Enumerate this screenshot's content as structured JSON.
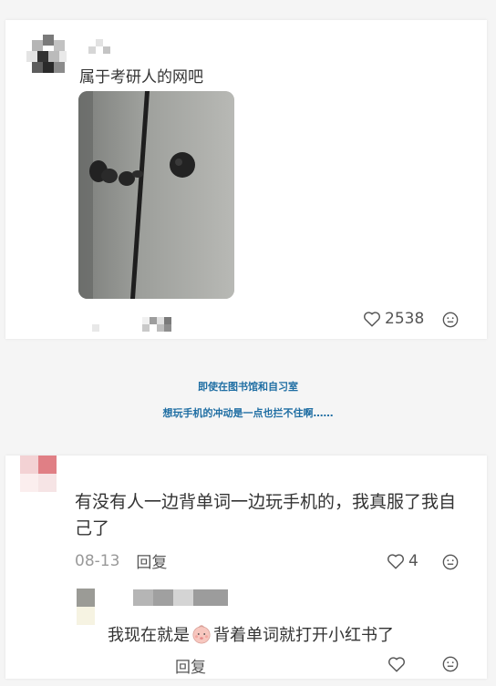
{
  "post": {
    "text": "属于考研人的网吧",
    "likes": "2538",
    "image_icon": "photo-of-white-cabinet-with-black-earbuds"
  },
  "caption": {
    "line1": "即使在图书馆和自习室",
    "line2": "想玩手机的冲动是一点也拦不住啊……"
  },
  "comment": {
    "text": "有没有人一边背单词一边玩手机的，我真服了我自己了",
    "date": "08-13",
    "reply_label": "回复",
    "likes": "4"
  },
  "sub_reply": {
    "text_before": "我现在就是",
    "emoji": "baby-face-emoji",
    "text_after": "背着单词就打开小红书了",
    "reply_label": "回复"
  },
  "colors": {
    "caption": "#1f6ea3",
    "card": "#ffffff",
    "background": "#f5f5f5"
  }
}
